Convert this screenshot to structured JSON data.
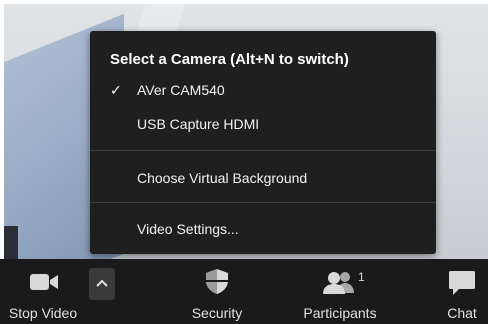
{
  "camera_menu": {
    "title": "Select a Camera (Alt+N to switch)",
    "items": [
      {
        "label": "AVer CAM540",
        "checked": true
      },
      {
        "label": "USB Capture HDMI",
        "checked": false
      }
    ],
    "check_glyph": "✓",
    "virtual_background_label": "Choose Virtual Background",
    "video_settings_label": "Video Settings..."
  },
  "toolbar": {
    "stop_video_label": "Stop Video",
    "security_label": "Security",
    "participants_label": "Participants",
    "participants_count": "1",
    "chat_label": "Chat",
    "icons": {
      "video": "video-camera-icon",
      "caret": "chevron-up-icon",
      "security": "shield-icon",
      "participants": "people-icon",
      "chat": "chat-bubble-icon"
    }
  },
  "colors": {
    "menu_bg": "#1f1f1f",
    "toolbar_bg": "#1a1a1a",
    "text": "#f2f2f2",
    "separator": "#3c3c3c"
  }
}
